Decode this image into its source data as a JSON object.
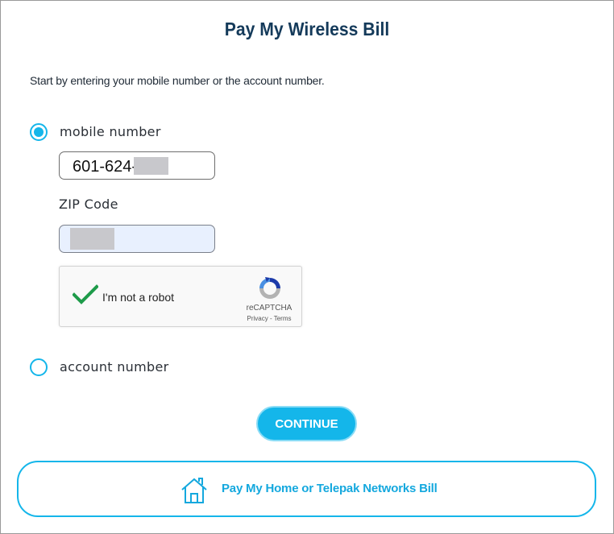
{
  "page": {
    "title": "Pay My Wireless Bill",
    "intro": "Start by entering your mobile number or the account number."
  },
  "options": {
    "mobile_label": "mobile number",
    "mobile_selected": true,
    "account_label": "account number",
    "account_selected": false
  },
  "form": {
    "phone_value": "601-624-",
    "zip_label": "ZIP Code"
  },
  "captcha": {
    "label": "I'm not a robot",
    "brand": "reCAPTCHA",
    "links": "Privacy - Terms",
    "checked": true
  },
  "actions": {
    "continue_label": "CONTINUE",
    "home_bill_label": "Pay My Home or Telepak Networks Bill"
  },
  "icons": {
    "check": "checkmark-icon",
    "recaptcha": "recaptcha-logo-icon",
    "home": "house-icon"
  },
  "colors": {
    "accent": "#14b6ea",
    "title": "#143a5a",
    "check_green": "#1e9b4a",
    "autofill_bg": "#e8f0fe"
  }
}
